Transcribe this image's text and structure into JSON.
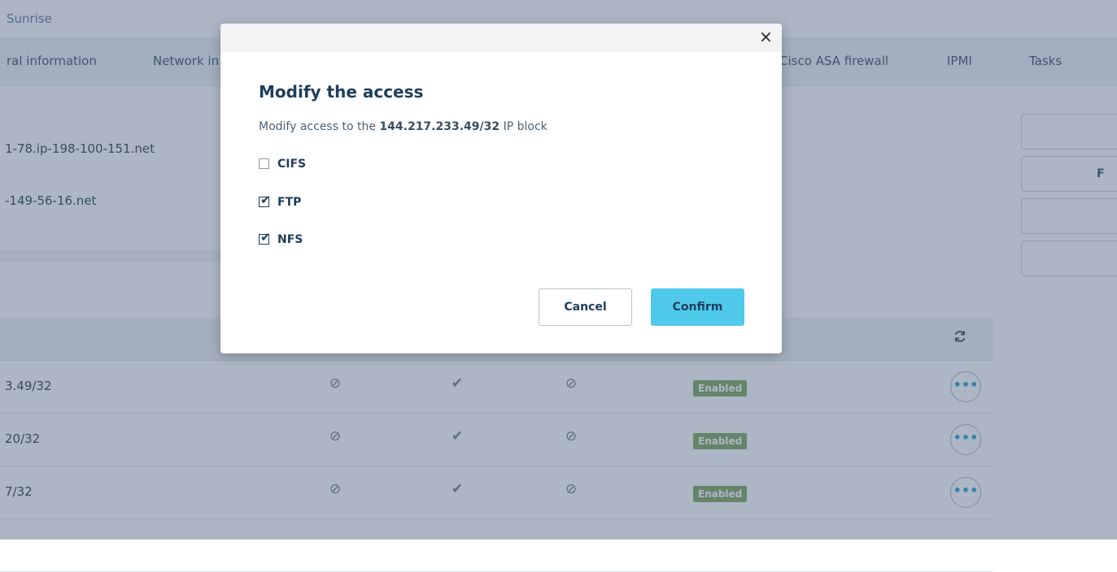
{
  "breadcrumb": "Sunrise",
  "tabs": [
    "ral information",
    "Network in",
    "Cisco ASA firewall",
    "IPMI",
    "Tasks"
  ],
  "hosts": [
    "1-78.ip-198-100-151.net",
    "-149-56-16.net"
  ],
  "side_button_label": "F",
  "table": {
    "refresh_icon": "refresh-icon",
    "rows": [
      {
        "ip": "3.49/32",
        "col1": "⊘",
        "col2": "✔",
        "col3": "⊘",
        "status": "Enabled",
        "more": "•••"
      },
      {
        "ip": "20/32",
        "col1": "⊘",
        "col2": "✔",
        "col3": "⊘",
        "status": "Enabled",
        "more": "•••"
      },
      {
        "ip": "7/32",
        "col1": "⊘",
        "col2": "✔",
        "col3": "⊘",
        "status": "Enabled",
        "more": "•••"
      }
    ]
  },
  "modal": {
    "close": "×",
    "title": "Modify the access",
    "desc_prefix": "Modify access to the",
    "ip_block": "144.217.233.49/32",
    "desc_suffix": "IP block",
    "options": [
      {
        "label": "CIFS",
        "checked": false
      },
      {
        "label": "FTP",
        "checked": true
      },
      {
        "label": "NFS",
        "checked": true
      }
    ],
    "cancel": "Cancel",
    "confirm": "Confirm"
  },
  "colors": {
    "confirm_bg": "#4fc9ea",
    "badge_bg": "#7fa65a",
    "title": "#1f3d5c"
  }
}
